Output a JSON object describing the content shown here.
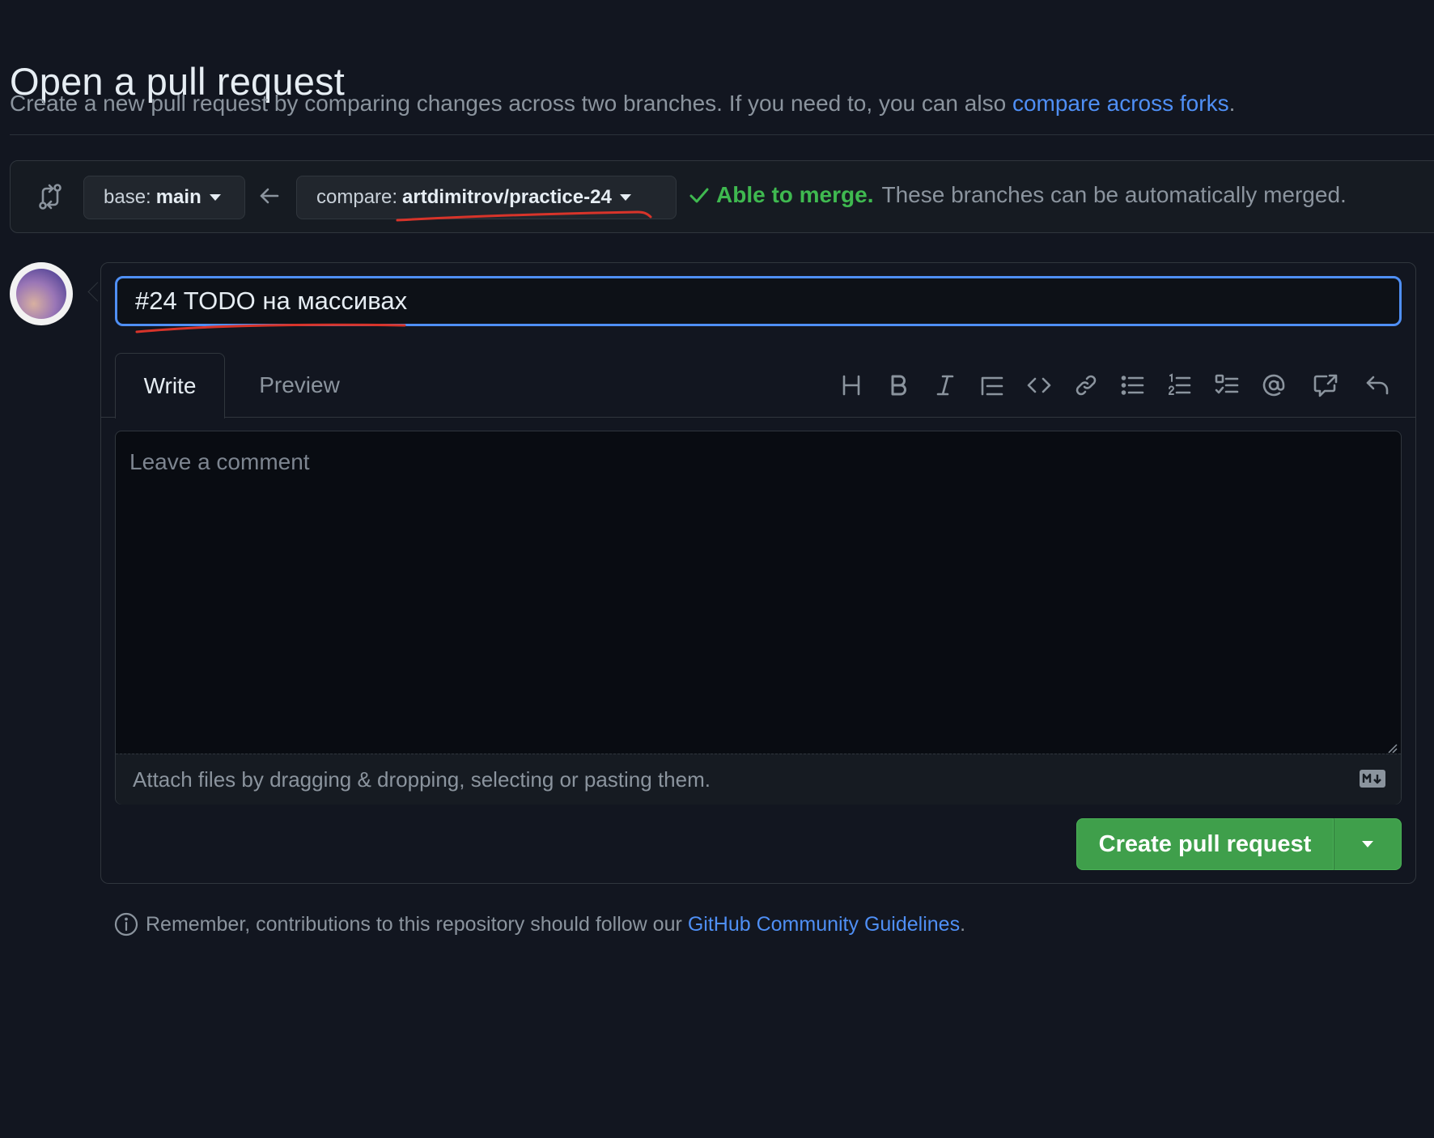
{
  "header": {
    "title": "Open a pull request",
    "subtitle": "Create a new pull request by comparing changes across two branches. If you need to, you can also",
    "subtitle_link": "compare across forks",
    "subtitle_end": "."
  },
  "compare": {
    "base_prefix": "base:",
    "base_branch": "main",
    "compare_prefix": "compare:",
    "compare_branch": "artdimitrov/practice-24",
    "merge_ok": "Able to merge.",
    "merge_msg": "These branches can be automatically merged."
  },
  "form": {
    "title_value": "#24 TODO на массивах",
    "tabs": {
      "write": "Write",
      "preview": "Preview"
    },
    "comment_placeholder": "Leave a comment",
    "attach_hint": "Attach files by dragging & dropping, selecting or pasting them.",
    "create_label": "Create pull request"
  },
  "toolbar_icons": [
    "heading-icon",
    "bold-icon",
    "italic-icon",
    "quote-icon",
    "code-icon",
    "link-icon",
    "unordered-list-icon",
    "ordered-list-icon",
    "task-list-icon",
    "mention-icon",
    "cross-reference-icon",
    "reply-icon"
  ],
  "footer": {
    "text": "Remember, contributions to this repository should follow our",
    "link": "GitHub Community Guidelines",
    "end": "."
  },
  "colors": {
    "background": "#121620",
    "accent_blue": "#4f8ff5",
    "success_green": "#3fb950",
    "button_green": "#3f9f4b",
    "annotation_red": "#d8342a"
  }
}
